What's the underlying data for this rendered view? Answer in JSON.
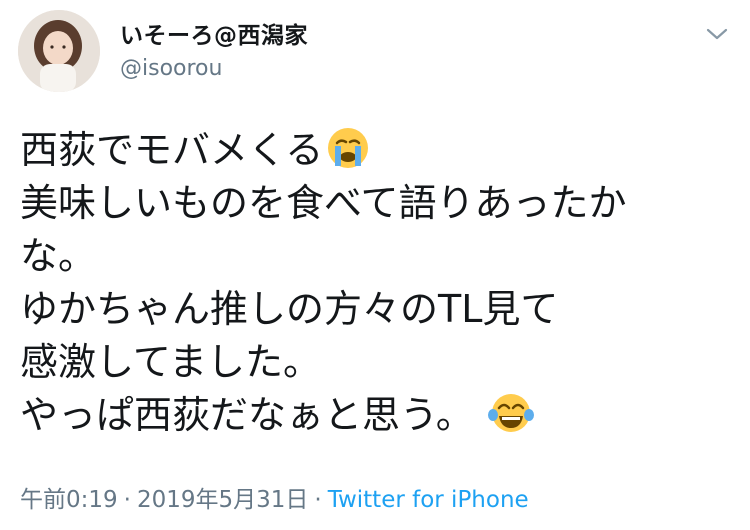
{
  "author": {
    "display_name": "いそーろ@西潟家",
    "handle": "@isoorou"
  },
  "tweet": {
    "lines": [
      "西荻でモバメくる",
      "美味しいものを食べて語りあったか",
      "な。",
      "ゆかちゃん推しの方々のTL見て",
      "感激してました。",
      "やっぱ西荻だなぁと思う。"
    ],
    "emojis": [
      "loudly-crying-face",
      "face-with-tears-of-joy"
    ]
  },
  "meta": {
    "time": "午前0:19",
    "separator": "·",
    "date": "2019年5月31日",
    "source": "Twitter for iPhone"
  },
  "colors": {
    "text": "#14171a",
    "secondary": "#657786",
    "link": "#1da1f2"
  }
}
